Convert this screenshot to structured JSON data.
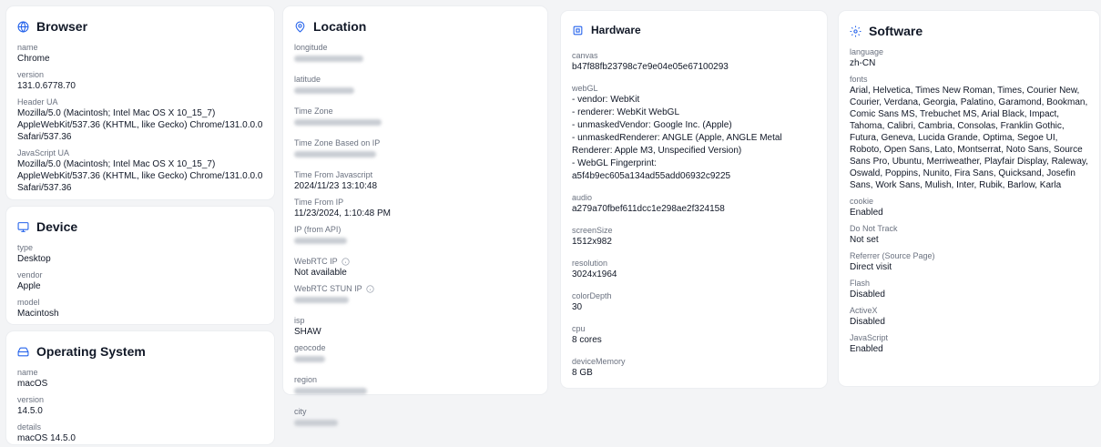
{
  "browser": {
    "title": "Browser",
    "name_label": "name",
    "name": "Chrome",
    "version_label": "version",
    "version": "131.0.6778.70",
    "header_ua_label": "Header UA",
    "header_ua": "Mozilla/5.0 (Macintosh; Intel Mac OS X 10_15_7) AppleWebKit/537.36 (KHTML, like Gecko) Chrome/131.0.0.0 Safari/537.36",
    "js_ua_label": "JavaScript UA",
    "js_ua": "Mozilla/5.0 (Macintosh; Intel Mac OS X 10_15_7) AppleWebKit/537.36 (KHTML, like Gecko) Chrome/131.0.0.0 Safari/537.36"
  },
  "device": {
    "title": "Device",
    "type_label": "type",
    "type": "Desktop",
    "vendor_label": "vendor",
    "vendor": "Apple",
    "model_label": "model",
    "model": "Macintosh"
  },
  "os": {
    "title": "Operating System",
    "name_label": "name",
    "name": "macOS",
    "version_label": "version",
    "version": "14.5.0",
    "details_label": "details",
    "details": "macOS 14.5.0"
  },
  "location": {
    "title": "Location",
    "longitude_label": "longitude",
    "latitude_label": "latitude",
    "timezone_label": "Time Zone",
    "timezone_ip_label": "Time Zone Based on IP",
    "time_js_label": "Time From Javascript",
    "time_js": "2024/11/23 13:10:48",
    "time_ip_label": "Time From IP",
    "time_ip": "11/23/2024, 1:10:48 PM",
    "ip_api_label": "IP (from API)",
    "webrtc_ip_label": "WebRTC IP",
    "webrtc_ip": "Not available",
    "webrtc_stun_label": "WebRTC STUN IP",
    "isp_label": "isp",
    "isp": "SHAW",
    "geocode_label": "geocode",
    "region_label": "region",
    "city_label": "city"
  },
  "hardware": {
    "title": "Hardware",
    "canvas_label": "canvas",
    "canvas": "b47f88fb23798c7e9e04e05e67100293",
    "webgl_label": "webGL",
    "webgl_lines": [
      "- vendor: WebKit",
      "- renderer: WebKit WebGL",
      "- unmaskedVendor: Google Inc. (Apple)",
      "- unmaskedRenderer: ANGLE (Apple, ANGLE Metal Renderer: Apple M3, Unspecified Version)",
      "- WebGL Fingerprint: a5f4b9ec605a134ad55add06932c9225"
    ],
    "audio_label": "audio",
    "audio": "a279a70fbef611dcc1e298ae2f324158",
    "screen_label": "screenSize",
    "screen": "1512x982",
    "resolution_label": "resolution",
    "resolution": "3024x1964",
    "color_label": "colorDepth",
    "color": "30",
    "cpu_label": "cpu",
    "cpu": "8 cores",
    "memory_label": "deviceMemory",
    "memory": "8 GB"
  },
  "software": {
    "title": "Software",
    "language_label": "language",
    "language": "zh-CN",
    "fonts_label": "fonts",
    "fonts": "Arial, Helvetica, Times New Roman, Times, Courier New, Courier, Verdana, Georgia, Palatino, Garamond, Bookman, Comic Sans MS, Trebuchet MS, Arial Black, Impact, Tahoma, Calibri, Cambria, Consolas, Franklin Gothic, Futura, Geneva, Lucida Grande, Optima, Segoe UI, Roboto, Open Sans, Lato, Montserrat, Noto Sans, Source Sans Pro, Ubuntu, Merriweather, Playfair Display, Raleway, Oswald, Poppins, Nunito, Fira Sans, Quicksand, Josefin Sans, Work Sans, Mulish, Inter, Rubik, Barlow, Karla",
    "cookie_label": "cookie",
    "cookie": "Enabled",
    "dnt_label": "Do Not Track",
    "dnt": "Not set",
    "referrer_label": "Referrer (Source Page)",
    "referrer": "Direct visit",
    "flash_label": "Flash",
    "flash": "Disabled",
    "activex_label": "ActiveX",
    "activex": "Disabled",
    "javascript_label": "JavaScript",
    "javascript": "Enabled"
  },
  "colors": {
    "accent": "#2563eb",
    "label": "#6b7280",
    "text": "#111827"
  }
}
